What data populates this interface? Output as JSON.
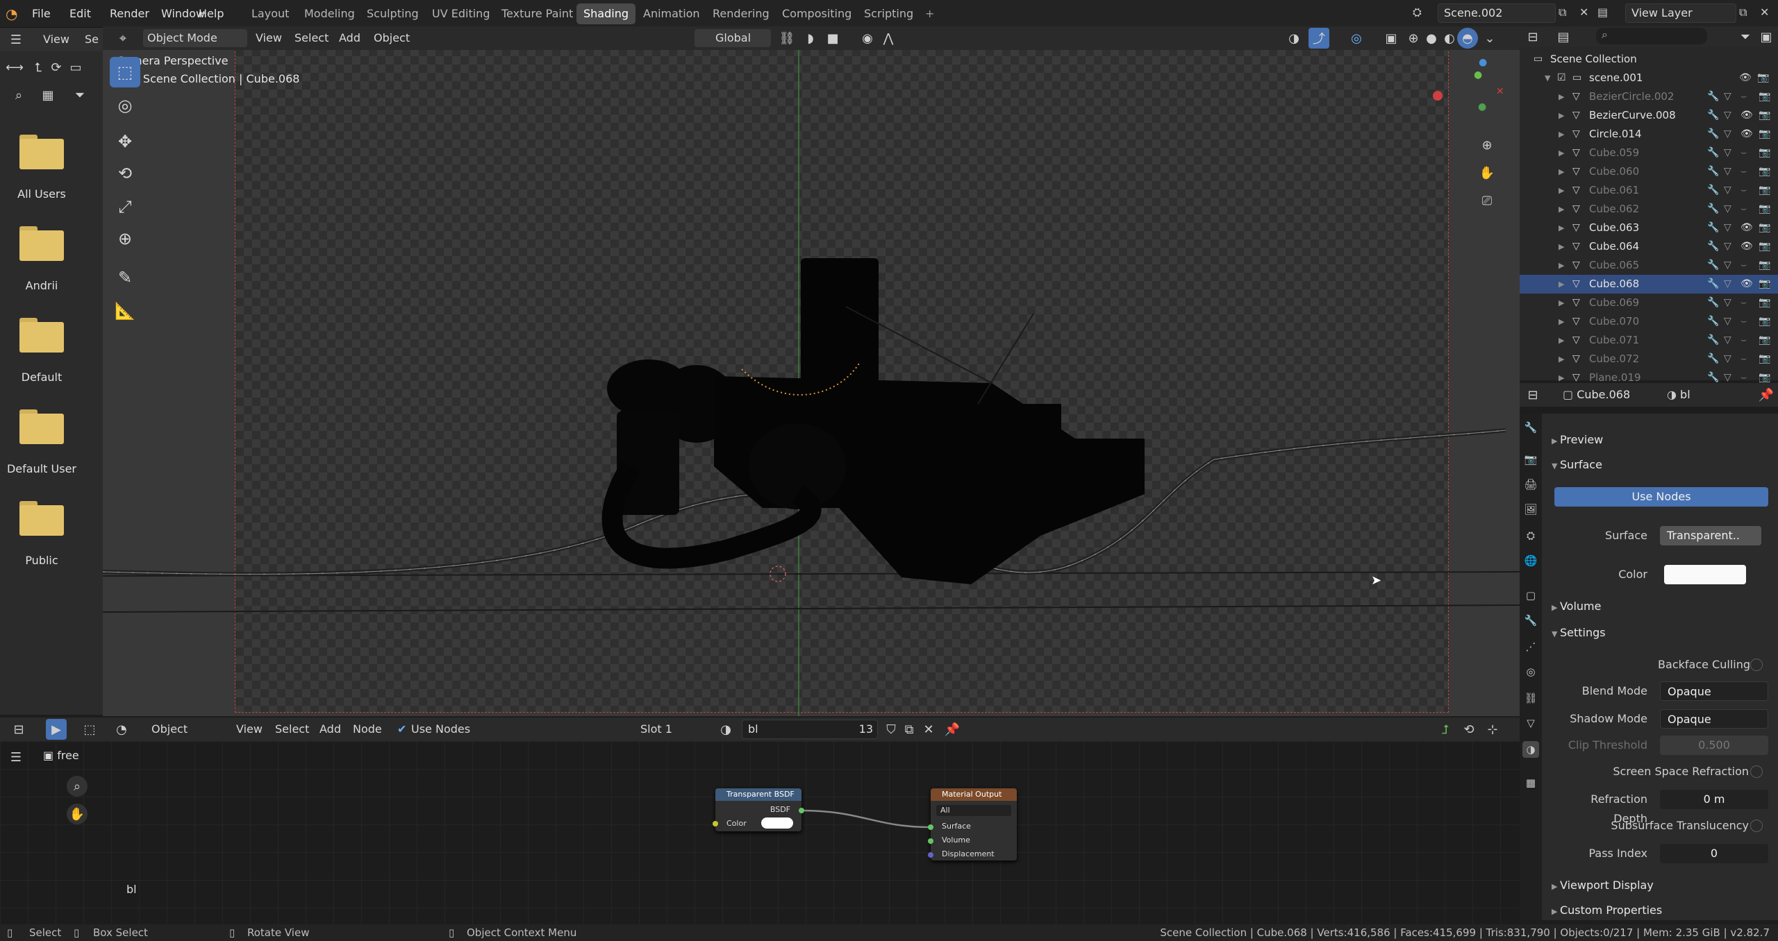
{
  "topbar": {
    "menus": [
      "File",
      "Edit",
      "Render",
      "Window",
      "Help"
    ],
    "workspaces": [
      "Layout",
      "Modeling",
      "Sculpting",
      "UV Editing",
      "Texture Paint",
      "Shading",
      "Animation",
      "Rendering",
      "Compositing",
      "Scripting"
    ],
    "active_workspace": "Shading",
    "scene": "Scene.002",
    "view_layer": "View Layer"
  },
  "viewport_header": {
    "mode": "Object Mode",
    "menus": [
      "View",
      "Select",
      "Add",
      "Object"
    ],
    "orientation": "Global",
    "left_view": "View",
    "left_cut": "Se"
  },
  "viewport": {
    "camera_label": "Camera Perspective",
    "collection_path": "(88) Scene Collection | Cube.068"
  },
  "filebrowser": {
    "folders": [
      "All Users",
      "Andrii",
      "Default",
      "Default User",
      "Public"
    ]
  },
  "outliner": {
    "root": "Scene Collection",
    "collection": "scene.001",
    "items": [
      {
        "name": "BezierCircle.002",
        "dim": true
      },
      {
        "name": "BezierCurve.008",
        "dim": false
      },
      {
        "name": "Circle.014",
        "dim": false
      },
      {
        "name": "Cube.059",
        "dim": true
      },
      {
        "name": "Cube.060",
        "dim": true
      },
      {
        "name": "Cube.061",
        "dim": true
      },
      {
        "name": "Cube.062",
        "dim": true
      },
      {
        "name": "Cube.063",
        "dim": false
      },
      {
        "name": "Cube.064",
        "dim": false
      },
      {
        "name": "Cube.065",
        "dim": true
      },
      {
        "name": "Cube.068",
        "dim": false,
        "selected": true
      },
      {
        "name": "Cube.069",
        "dim": true
      },
      {
        "name": "Cube.070",
        "dim": true
      },
      {
        "name": "Cube.071",
        "dim": true
      },
      {
        "name": "Cube.072",
        "dim": true
      },
      {
        "name": "Plane.019",
        "dim": true
      }
    ]
  },
  "properties": {
    "object": "Cube.068",
    "material": "bl",
    "preview": "Preview",
    "surface_panel": "Surface",
    "use_nodes": "Use Nodes",
    "surface_label": "Surface",
    "surface_value": "Transparent..",
    "color_label": "Color",
    "volume": "Volume",
    "settings": "Settings",
    "backface": "Backface Culling",
    "blend_label": "Blend Mode",
    "blend_value": "Opaque",
    "shadow_label": "Shadow Mode",
    "shadow_value": "Opaque",
    "clip_label": "Clip Threshold",
    "clip_value": "0.500",
    "ssr": "Screen Space Refraction",
    "refr_label": "Refraction Depth",
    "refr_value": "0 m",
    "sst": "Subsurface Translucency",
    "pass_label": "Pass Index",
    "pass_value": "0",
    "viewport_display": "Viewport Display",
    "custom_props": "Custom Properties"
  },
  "node_header": {
    "mode": "Object",
    "menus": [
      "View",
      "Select",
      "Add",
      "Node"
    ],
    "use_nodes": "Use Nodes",
    "slot": "Slot 1",
    "material": "bl",
    "users": "13",
    "free": "free"
  },
  "nodes": {
    "transparent": {
      "title": "Transparent BSDF",
      "out": "BSDF",
      "color": "Color"
    },
    "output": {
      "title": "Material Output",
      "target": "All",
      "inputs": [
        "Surface",
        "Volume",
        "Displacement"
      ]
    },
    "label": "bl"
  },
  "statusbar": {
    "select": "Select",
    "box_select": "Box Select",
    "rotate": "Rotate View",
    "context": "Object Context Menu",
    "stats": "Scene Collection | Cube.068 | Verts:416,586 | Faces:415,699 | Tris:831,790 | Objects:0/217 | Mem: 2.35 GiB | v2.82.7"
  }
}
